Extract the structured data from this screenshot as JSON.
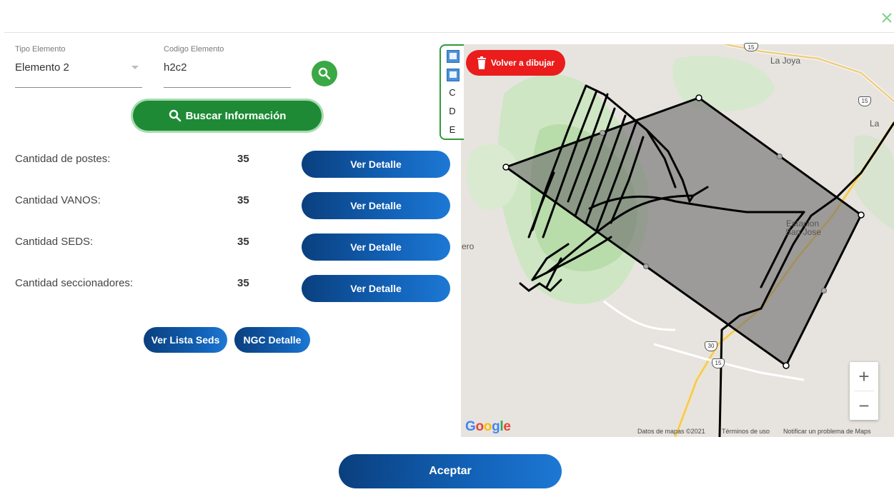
{
  "dialog": {
    "close_icon": "close-icon",
    "accent_green": "#3aa845"
  },
  "filters": {
    "tipo_label": "Tipo Elemento",
    "tipo_value": "Elemento 2",
    "codigo_label": "Codigo Elemento",
    "codigo_value": "h2c2"
  },
  "buscar_label": "Buscar Información",
  "rows": [
    {
      "label": "Cantidad de postes:",
      "count": "35",
      "button": "Ver Detalle"
    },
    {
      "label": "Cantidad VANOS:",
      "count": "35",
      "button": "Ver Detalle"
    },
    {
      "label": "Cantidad SEDS:",
      "count": "35",
      "button": "Ver Detalle"
    },
    {
      "label": "Cantidad seccionadores:",
      "count": "35",
      "button": "Ver Detalle"
    }
  ],
  "actions": {
    "lista_seds": "Ver Lista Seds",
    "ngc_detalle": "NGC Detalle"
  },
  "map": {
    "volver_label": "Volver a dibujar",
    "toolbar_letters": [
      "C",
      "D",
      "E"
    ],
    "labels": {
      "la_joya": "La Joya",
      "la": "La",
      "estacion": "Estacion",
      "san_jose": "San Jose",
      "ero": "ero"
    },
    "shields": {
      "s15a": "15",
      "s15b": "15",
      "s30": "30",
      "s15c": "15"
    },
    "google": [
      "G",
      "o",
      "o",
      "g",
      "l",
      "e"
    ],
    "footer": {
      "datos": "Datos de mapas ©2021",
      "terminos": "Términos de uso",
      "notificar": "Notificar un problema de Maps"
    },
    "zoom_in": "+",
    "zoom_out": "−"
  },
  "aceptar_label": "Aceptar"
}
